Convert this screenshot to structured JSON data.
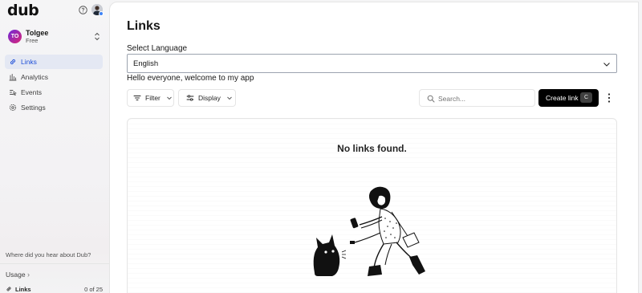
{
  "app": {
    "logo": "dub"
  },
  "workspace": {
    "initials": "TO",
    "name": "Tolgee",
    "plan": "Free"
  },
  "sidebar": {
    "items": [
      {
        "label": "Links",
        "icon": "link-icon",
        "active": true
      },
      {
        "label": "Analytics",
        "icon": "bar-chart-icon",
        "active": false
      },
      {
        "label": "Events",
        "icon": "events-icon",
        "active": false
      },
      {
        "label": "Settings",
        "icon": "gear-icon",
        "active": false
      }
    ],
    "question": "Where did you hear about Dub?",
    "usage_label": "Usage",
    "usage_chevron": "›",
    "usage_row": {
      "label": "Links",
      "count": "0 of 25"
    }
  },
  "main": {
    "title": "Links",
    "language_label": "Select Language",
    "language_value": "English",
    "greeting": "Hello everyone, welcome to my app",
    "filter_label": "Filter",
    "display_label": "Display",
    "search_placeholder": "Search...",
    "create_label": "Create link",
    "create_shortcut": "C",
    "empty_title": "No links found."
  },
  "colors": {
    "accent": "#1d4ed8",
    "active_bg": "#e4e8f3",
    "primary_button": "#000000",
    "workspace_gradient_start": "#6d28d9",
    "workspace_gradient_end": "#db2777"
  }
}
